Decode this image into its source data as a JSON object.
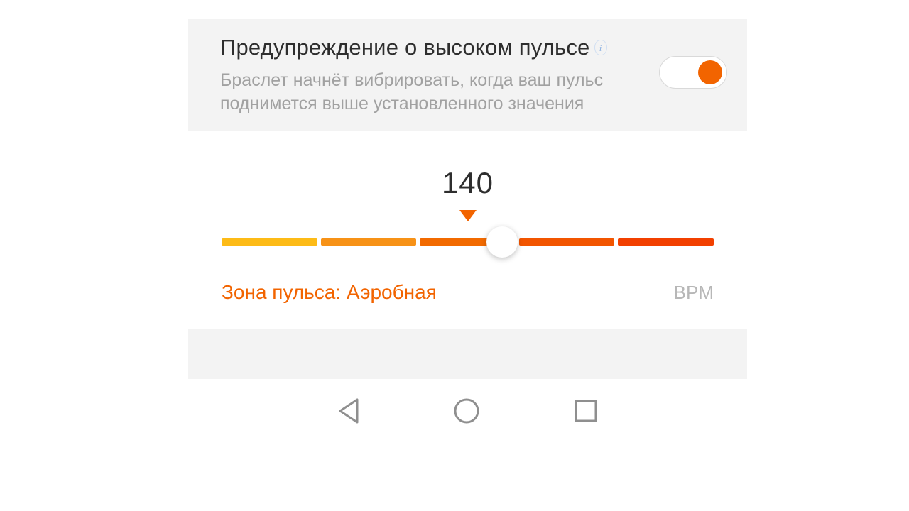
{
  "colors": {
    "accent": "#f26400"
  },
  "header": {
    "title": "Предупреждение о высоком пульсе",
    "description": "Браслет начнёт вибрировать, когда ваш пульс поднимется выше установленного значения",
    "info_icon": "i",
    "toggle_on": true
  },
  "slider": {
    "value": "140",
    "zone_prefix": "Зона пульса: ",
    "zone_name": "Аэробная",
    "unit": "BPM",
    "thumb_percent": 57
  }
}
